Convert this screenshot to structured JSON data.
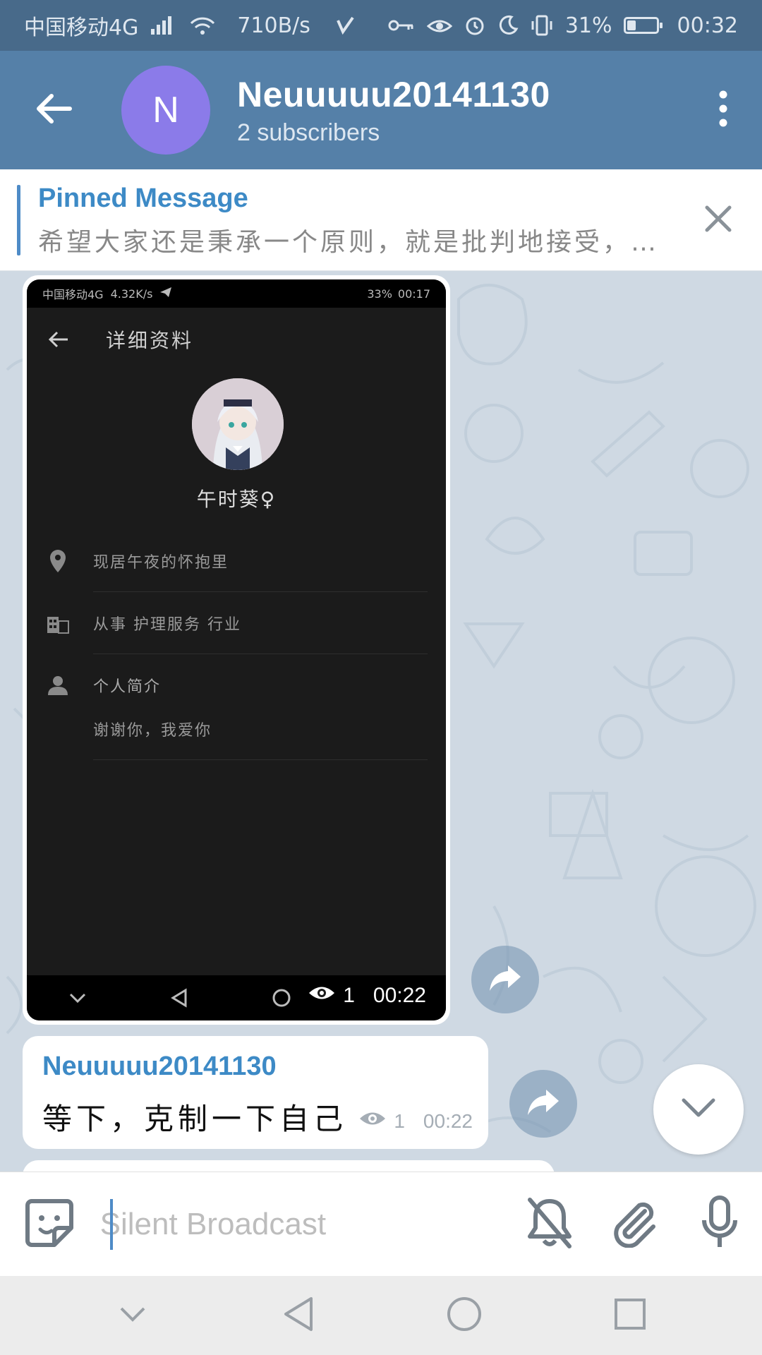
{
  "status_bar": {
    "carrier": "中国移动4G",
    "net_speed": "710B/s",
    "battery": "31%",
    "battery_level": 0.31,
    "time": "00:32"
  },
  "app_bar": {
    "avatar_letter": "N",
    "title": "Neuuuuu20141130",
    "subtitle": "2 subscribers"
  },
  "pinned": {
    "title": "Pinned Message",
    "text": "希望大家还是秉承一个原则，就是批判地接受，…"
  },
  "photo_message": {
    "screenshot": {
      "status_carrier": "中国移动4G",
      "status_speed": "4.32K/s",
      "status_battery": "33%",
      "status_time": "00:17",
      "header_title": "详细资料",
      "name": "午时葵♀",
      "location": "现居午夜的怀抱里",
      "occupation": "从事 护理服务 行业",
      "bio_label": "个人简介",
      "bio": "谢谢你，我爱你"
    },
    "views": "1",
    "time": "00:22"
  },
  "text_message": {
    "author": "Neuuuuu20141130",
    "text": "等下，克制一下自己",
    "views": "1",
    "time": "00:22"
  },
  "input": {
    "placeholder": "Silent Broadcast",
    "value": ""
  },
  "colors": {
    "header": "#5580a8",
    "status_bar": "#486a8a",
    "accent": "#3d8ac6",
    "avatar": "#8b7be9",
    "chat_bg": "#cfd9e3"
  },
  "icons": [
    "back-arrow-icon",
    "more-vert-icon",
    "close-icon",
    "share-icon",
    "chevron-down-icon",
    "sticker-icon",
    "bell-off-icon",
    "paperclip-icon",
    "microphone-icon",
    "eye-icon"
  ]
}
